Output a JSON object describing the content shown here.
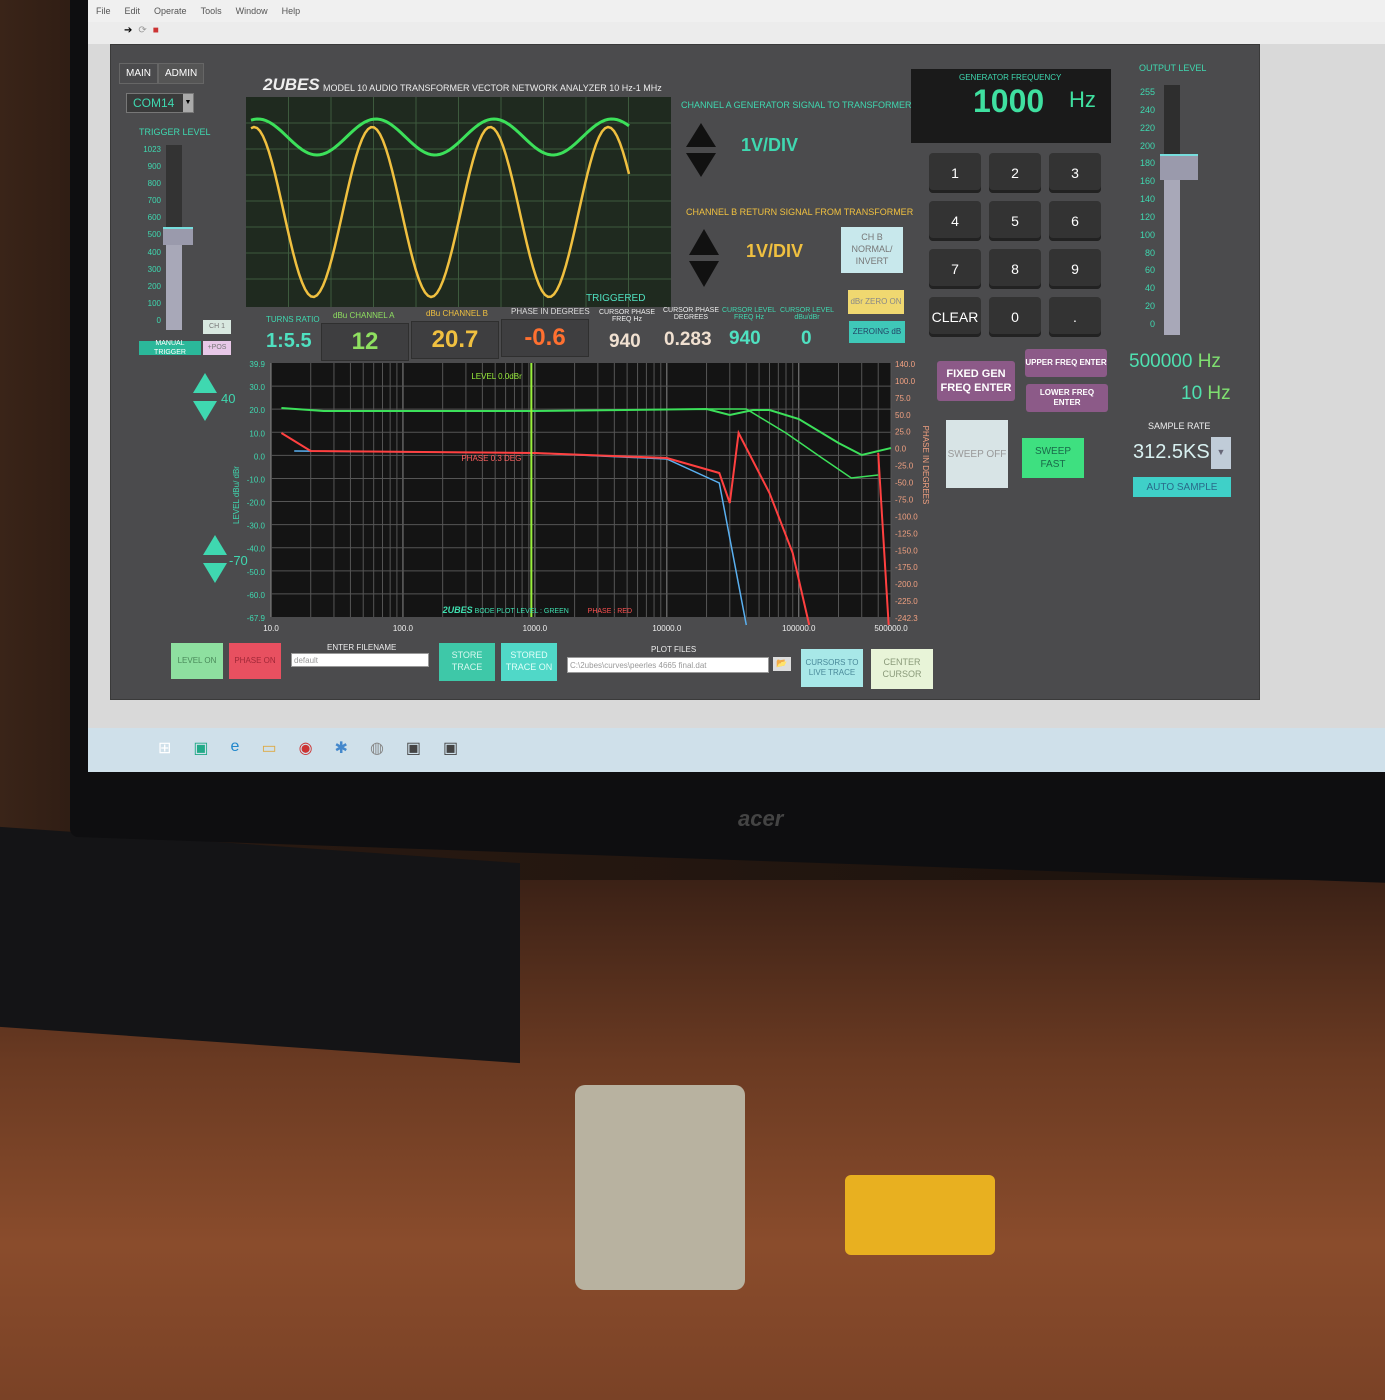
{
  "menu": [
    "File",
    "Edit",
    "Operate",
    "Tools",
    "Window",
    "Help"
  ],
  "tabs": [
    "MAIN",
    "ADMIN"
  ],
  "com_port": "COM14",
  "title": {
    "brand": "2UBES",
    "subtitle": "MODEL 10 AUDIO TRANSFORMER  VECTOR NETWORK ANALYZER  10 Hz-1 MHz"
  },
  "trigger": {
    "label": "TRIGGER LEVEL",
    "ticks": [
      "1023",
      "900",
      "800",
      "700",
      "600",
      "500",
      "400",
      "300",
      "200",
      "100",
      "0"
    ],
    "value": 530,
    "ch_button": "CH 1",
    "manual_trigger": "MANUAL TRIGGER",
    "pos_button": "+POS"
  },
  "scope": {
    "status": "TRIGGERED"
  },
  "channel_a": {
    "label": "CHANNEL A  GENERATOR  SIGNAL TO TRANSFORMER",
    "scale": "1V/DIV"
  },
  "channel_b": {
    "label": "CHANNEL B   RETURN SIGNAL  FROM TRANSFORMER",
    "scale": "1V/DIV",
    "invert_button": "CH B NORMAL/ INVERT"
  },
  "readouts": {
    "turns_ratio_label": "TURNS RATIO",
    "turns_ratio": "1:5.5",
    "cha_label": "dBu CHANNEL A",
    "cha": "12",
    "chb_label": "dBu CHANNEL B",
    "chb": "20.7",
    "phase_label": "PHASE  IN DEGREES",
    "phase": "-0.6",
    "cursor_phase_freq_label": "CURSOR  PHASE FREQ Hz",
    "cursor_phase_freq": "940",
    "cursor_phase_deg_label": "CURSOR PHASE DEGREES",
    "cursor_phase_deg": "0.283",
    "cursor_level_freq_label": "CURSOR LEVEL FREQ  Hz",
    "cursor_level_freq": "940",
    "cursor_level_db_label": "CURSOR LEVEL dBu/dBr",
    "cursor_level_db": "0"
  },
  "dbr_zero": "dBr ZERO ON",
  "zeroing": "ZEROING dB",
  "generator": {
    "label": "GENERATOR FREQUENCY",
    "value": "1000",
    "unit": "Hz"
  },
  "keypad": [
    "1",
    "2",
    "3",
    "4",
    "5",
    "6",
    "7",
    "8",
    "9",
    "CLEAR",
    "0",
    "."
  ],
  "output_level": {
    "label": "OUTPUT LEVEL",
    "ticks": [
      "255",
      "240",
      "220",
      "200",
      "180",
      "160",
      "140",
      "120",
      "100",
      "80",
      "60",
      "40",
      "20",
      "0"
    ],
    "value": 170
  },
  "freq": {
    "fixed": "FIXED GEN FREQ ENTER",
    "upper": "UPPER FREQ ENTER",
    "lower": "LOWER FREQ ENTER",
    "upper_value": "500000",
    "lower_value": "10",
    "unit": "Hz"
  },
  "sweep": {
    "off": "SWEEP OFF",
    "fast": "SWEEP FAST"
  },
  "sample": {
    "label": "SAMPLE RATE",
    "value": "312.5KS",
    "auto": "AUTO SAMPLE"
  },
  "level_controls": {
    "upper": "40",
    "lower": "-70"
  },
  "bode": {
    "cursor_label": "LEVEL 0.0dBr",
    "phase_label": "PHASE 0.3 DEG",
    "footer_brand": "2UBES",
    "footer_text": "BODE PLOT   LEVEL : GREEN",
    "footer_phase": "PHASE : RED",
    "left_axis_title": "LEVEL  dBu/ dBr",
    "right_axis_title": "PHASE IN DEGREES",
    "left_ticks": [
      "39.9",
      "30.0",
      "20.0",
      "10.0",
      "0.0",
      "-10.0",
      "-20.0",
      "-30.0",
      "-40.0",
      "-50.0",
      "-60.0",
      "-67.9"
    ],
    "right_ticks": [
      "140.0",
      "100.0",
      "75.0",
      "50.0",
      "25.0",
      "0.0",
      "-25.0",
      "-50.0",
      "-75.0",
      "-100.0",
      "-125.0",
      "-150.0",
      "-175.0",
      "-200.0",
      "-225.0",
      "-242.3"
    ],
    "x_ticks": [
      "10.0",
      "100.0",
      "1000.0",
      "10000.0",
      "100000.0",
      "500000.0"
    ],
    "colors": {
      "level": "#3ce05a",
      "phase": "#ff4040",
      "cursor": "#9af03c"
    }
  },
  "bottom": {
    "level_on": "LEVEL ON",
    "phase_on": "PHASE ON",
    "filename_label": "ENTER  FILENAME",
    "filename": "default",
    "store": "STORE TRACE",
    "stored_on": "STORED TRACE ON",
    "plot_files_label": "PLOT FILES",
    "plot_file": "C:\\2ubes\\curves\\peerles 4665 final.dat",
    "cursors_live": "CURSORS TO LIVE TRACE",
    "center_cursor": "CENTER CURSOR"
  },
  "monitor_brand": "acer"
}
